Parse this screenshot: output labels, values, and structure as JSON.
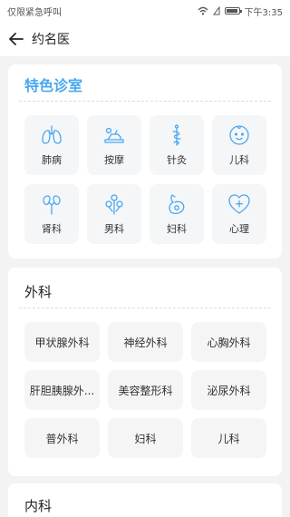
{
  "status_bar": {
    "left_text": "仅限紧急呼叫",
    "time": "下午3:35"
  },
  "header": {
    "title": "约名医"
  },
  "special_clinic": {
    "title": "特色诊室",
    "accent_color": "#4aa8f0",
    "items": [
      {
        "label": "肺病",
        "icon": "lungs-icon"
      },
      {
        "label": "按摩",
        "icon": "massage-icon"
      },
      {
        "label": "针灸",
        "icon": "acupuncture-icon"
      },
      {
        "label": "儿科",
        "icon": "baby-icon"
      },
      {
        "label": "肾科",
        "icon": "kidney-icon"
      },
      {
        "label": "男科",
        "icon": "male-icon"
      },
      {
        "label": "妇科",
        "icon": "pregnancy-icon"
      },
      {
        "label": "心理",
        "icon": "heart-icon"
      }
    ]
  },
  "surgery": {
    "title": "外科",
    "items": [
      "甲状腺外科",
      "神经外科",
      "心胸外科",
      "肝胆胰腺外...",
      "美容整形科",
      "泌尿外科",
      "普外科",
      "妇科",
      "儿科"
    ]
  },
  "internal": {
    "title": "内科"
  }
}
